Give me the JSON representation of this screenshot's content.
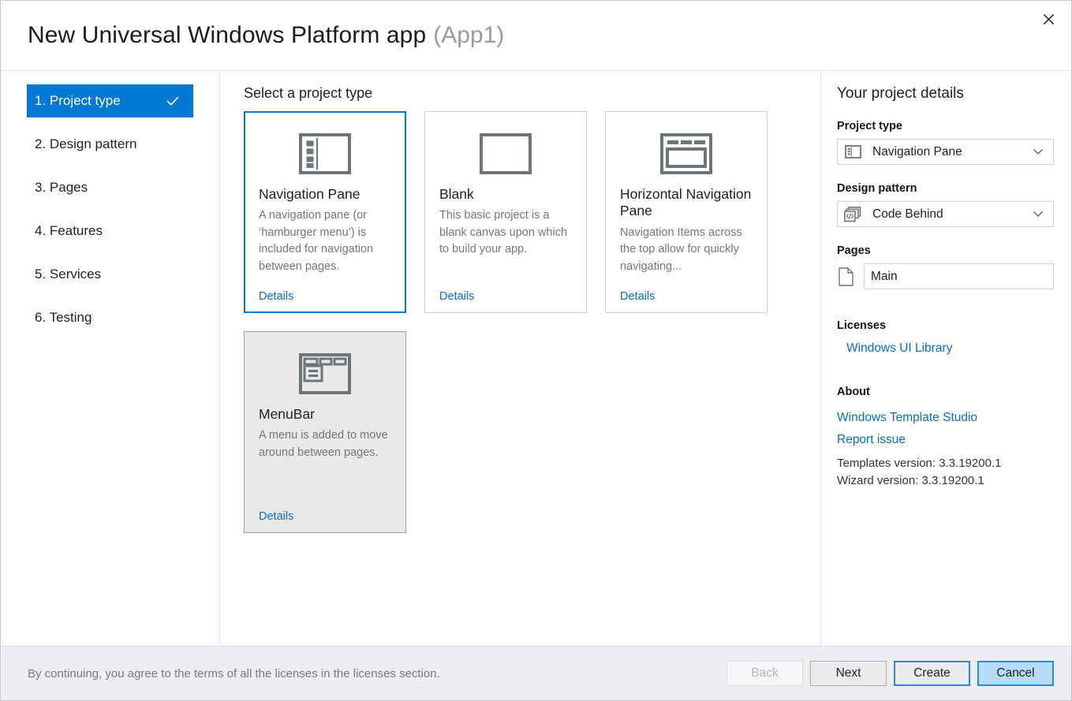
{
  "window": {
    "title": "New Universal Windows Platform app",
    "app_name": "(App1)",
    "close_icon": "close-icon"
  },
  "sidebar": {
    "items": [
      {
        "label": "1. Project type",
        "selected": true,
        "completed": true
      },
      {
        "label": "2. Design pattern",
        "selected": false,
        "completed": false
      },
      {
        "label": "3. Pages",
        "selected": false,
        "completed": false
      },
      {
        "label": "4. Features",
        "selected": false,
        "completed": false
      },
      {
        "label": "5. Services",
        "selected": false,
        "completed": false
      },
      {
        "label": "6. Testing",
        "selected": false,
        "completed": false
      }
    ]
  },
  "main": {
    "heading": "Select a project type",
    "cards": [
      {
        "title": "Navigation Pane",
        "description": "A navigation pane (or ‘hamburger menu’) is included for navigation between pages.",
        "details_label": "Details",
        "icon": "navigation-pane-icon",
        "state": "selected"
      },
      {
        "title": "Blank",
        "description": "This basic project is a blank canvas upon which to build your app.",
        "details_label": "Details",
        "icon": "blank-page-icon",
        "state": "normal"
      },
      {
        "title": "Horizontal Navigation Pane",
        "description": "Navigation Items across the top allow for quickly navigating...",
        "details_label": "Details",
        "icon": "horizontal-navigation-pane-icon",
        "state": "normal"
      },
      {
        "title": "MenuBar",
        "description": "A menu is added to move around between pages.",
        "details_label": "Details",
        "icon": "menubar-icon",
        "state": "hovered"
      }
    ]
  },
  "details_panel": {
    "heading": "Your project details",
    "project_type": {
      "label": "Project type",
      "value": "Navigation Pane",
      "icon": "navigation-pane-icon",
      "chevron": "chevron-down-icon"
    },
    "design_pattern": {
      "label": "Design pattern",
      "value": "Code Behind",
      "icon": "code-behind-icon",
      "chevron": "chevron-down-icon"
    },
    "pages": {
      "label": "Pages",
      "items": [
        {
          "name": "Main",
          "icon": "page-document-icon"
        }
      ]
    },
    "licenses": {
      "label": "Licenses",
      "links": [
        "Windows UI Library"
      ]
    },
    "about": {
      "label": "About",
      "links": [
        "Windows Template Studio",
        "Report issue"
      ],
      "templates_version": "Templates version: 3.3.19200.1",
      "wizard_version": "Wizard version: 3.3.19200.1"
    }
  },
  "footer": {
    "note": "By continuing, you agree to the terms of all the licenses in the licenses section.",
    "buttons": {
      "back": "Back",
      "next": "Next",
      "create": "Create",
      "cancel": "Cancel"
    }
  },
  "colors": {
    "accent": "#0078d4",
    "link": "#0a6cc4",
    "icon_gray": "#6e7578",
    "muted_text": "#767676",
    "footer_bg": "#eeeef2"
  }
}
